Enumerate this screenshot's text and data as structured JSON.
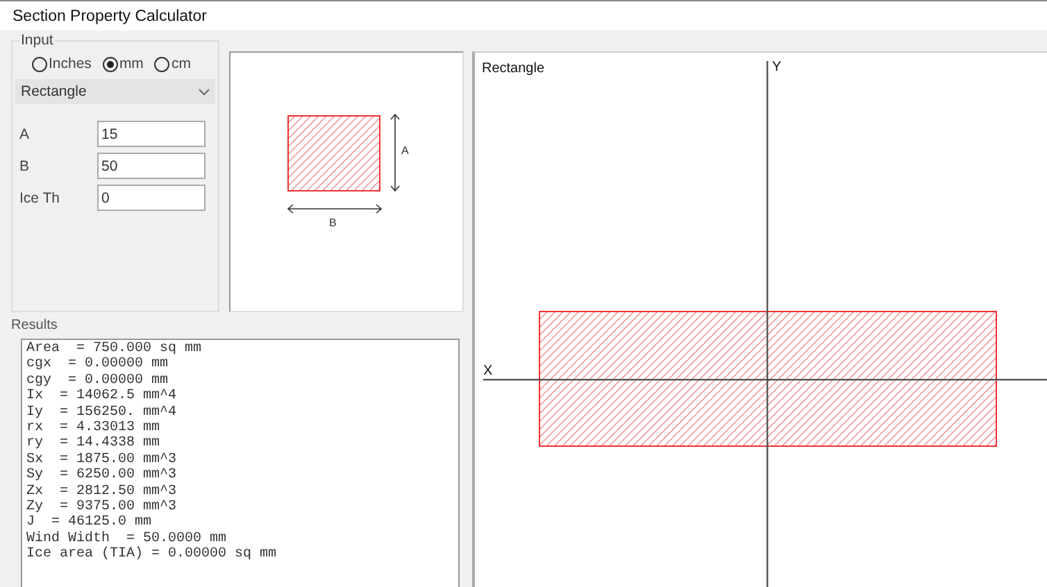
{
  "window": {
    "title": "Section Property Calculator"
  },
  "input": {
    "title": "Input",
    "units": [
      {
        "label": "Inches",
        "selected": false
      },
      {
        "label": "mm",
        "selected": true
      },
      {
        "label": "cm",
        "selected": false
      }
    ],
    "shape": {
      "value": "Rectangle"
    },
    "fields": [
      {
        "label": "A",
        "value": "15"
      },
      {
        "label": "B",
        "value": "50"
      },
      {
        "label": "Ice Th",
        "value": "0"
      }
    ]
  },
  "preview": {
    "height_label": "A",
    "width_label": "B"
  },
  "results": {
    "title": "Results",
    "lines": [
      "Area  = 750.000 sq mm",
      "cgx  = 0.00000 mm",
      "cgy  = 0.00000 mm",
      "Ix  = 14062.5 mm^4",
      "Iy  = 156250. mm^4",
      "rx  = 4.33013 mm",
      "ry  = 14.4338 mm",
      "Sx  = 1875.00 mm^3",
      "Sy  = 6250.00 mm^3",
      "Zx  = 2812.50 mm^3",
      "Zy  = 9375.00 mm^3",
      "J  = 46125.0 mm",
      "Wind Width  = 50.0000 mm",
      "Ice area (TIA) = 0.00000 sq mm"
    ]
  },
  "canvas": {
    "title": "Rectangle",
    "x_label": "X",
    "y_label": "Y"
  }
}
